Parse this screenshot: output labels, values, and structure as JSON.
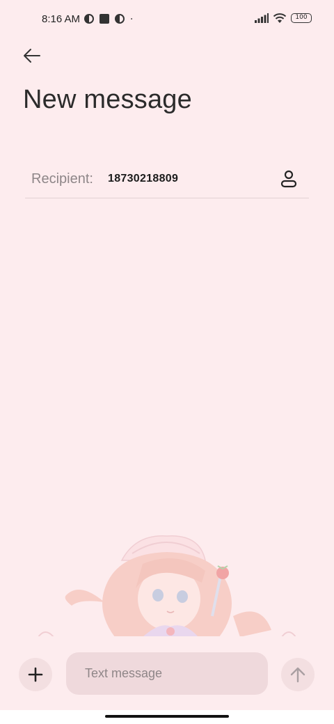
{
  "status_bar": {
    "time": "8:16 AM",
    "battery": "100",
    "icons": [
      "app-notification-icon",
      "square-notification-icon",
      "app-notification-icon",
      "dot-icon",
      "signal-icon",
      "wifi-icon",
      "battery-icon"
    ]
  },
  "header": {
    "back_icon": "arrow-left-icon",
    "title": "New message"
  },
  "recipient": {
    "label": "Recipient:",
    "value": "18730218809",
    "contact_icon": "person-icon"
  },
  "composer": {
    "attach_icon": "plus-icon",
    "placeholder": "Text message",
    "value": "",
    "send_icon": "arrow-up-icon"
  },
  "colors": {
    "background": "#fdecee",
    "input_background": "#efd9dc",
    "button_background": "#f3dfe1"
  }
}
